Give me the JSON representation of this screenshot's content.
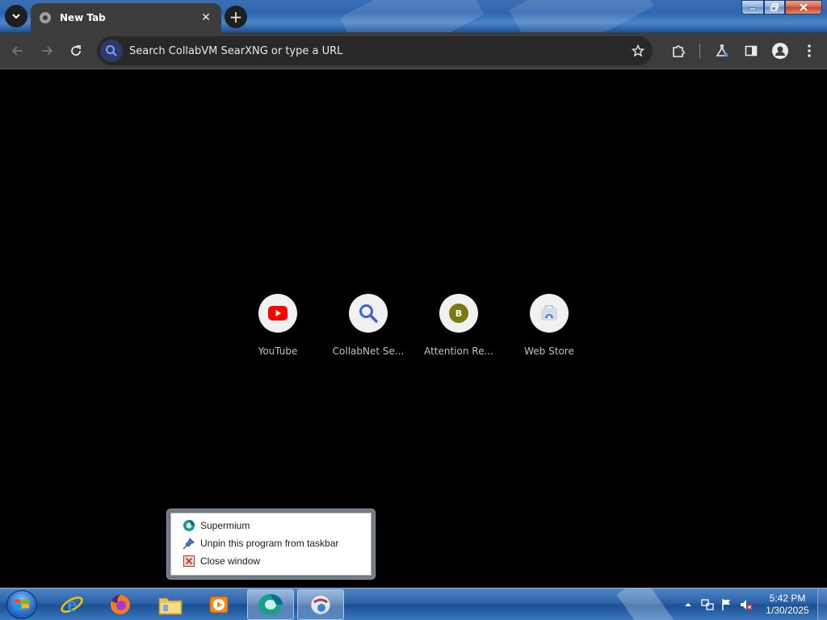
{
  "browser": {
    "tab": {
      "title": "New Tab"
    },
    "omnibox": {
      "placeholder": "Search CollabVM SearXNG or type a URL"
    }
  },
  "shortcuts": [
    {
      "label": "YouTube",
      "icon": "youtube-icon"
    },
    {
      "label": "CollabNet Se...",
      "icon": "magnifier-icon"
    },
    {
      "label": "Attention Re...",
      "icon": "letter-b-icon",
      "letter": "B"
    },
    {
      "label": "Web Store",
      "icon": "web-store-icon"
    }
  ],
  "jumplist": {
    "items": [
      {
        "label": "Supermium",
        "icon": "supermium-icon"
      },
      {
        "label": "Unpin this program from taskbar",
        "icon": "unpin-icon"
      },
      {
        "label": "Close window",
        "icon": "close-window-icon"
      }
    ]
  },
  "taskbar": {
    "apps": [
      "internet-explorer-icon",
      "firefox-icon",
      "file-explorer-icon",
      "media-player-icon",
      "supermium-icon",
      "network-globe-icon"
    ],
    "clock": {
      "time": "5:42 PM",
      "date": "1/30/2025"
    }
  },
  "colors": {
    "titlebar": "#2f66b0",
    "toolbar": "#3c3c3c",
    "omnibox": "#282828",
    "content": "#000000",
    "taskbar": "#2c62a8",
    "youtube_red": "#ff0000",
    "accent_blue": "#3f5ee8"
  }
}
